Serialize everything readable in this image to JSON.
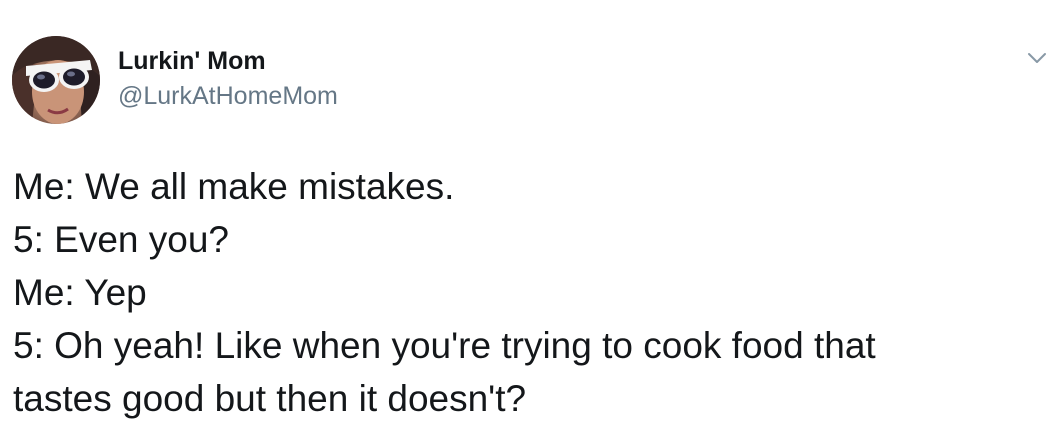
{
  "author": {
    "display_name": "Lurkin' Mom",
    "username": "@LurkAtHomeMom",
    "avatar_icon": "profile-photo"
  },
  "menu": {
    "icon": "chevron-down-icon"
  },
  "tweet": {
    "lines": [
      "Me: We all make mistakes.",
      "5: Even you?",
      "Me: Yep",
      "5: Oh yeah! Like when you're trying to cook food that",
      "tastes good but then it doesn't?"
    ]
  },
  "colors": {
    "text": "#14171a",
    "secondary_text": "#657786",
    "background": "#ffffff"
  }
}
